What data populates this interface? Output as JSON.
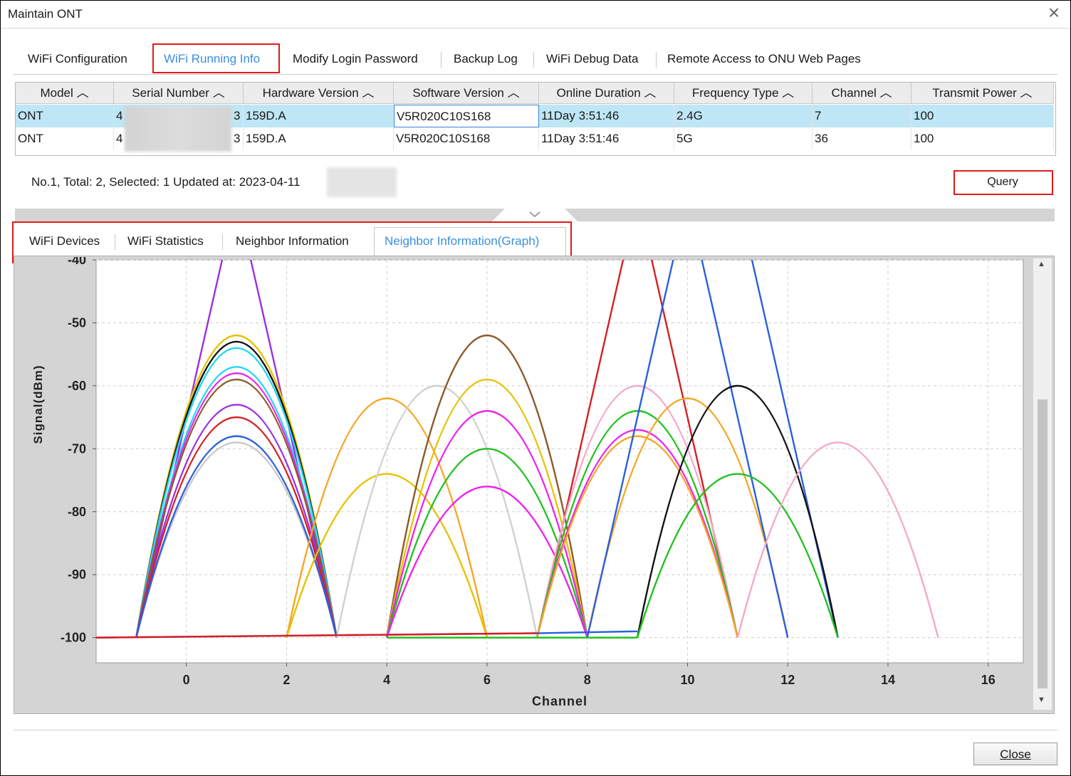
{
  "window": {
    "title": "Maintain ONT"
  },
  "top_tabs": [
    {
      "label": "WiFi Configuration",
      "active": false
    },
    {
      "label": "WiFi Running Info",
      "active": true
    },
    {
      "label": "Modify Login Password",
      "active": false
    },
    {
      "label": "Backup Log",
      "active": false
    },
    {
      "label": "WiFi Debug Data",
      "active": false
    },
    {
      "label": "Remote Access to ONU Web Pages",
      "active": false
    }
  ],
  "table": {
    "columns": [
      "Model",
      "Serial Number",
      "Hardware Version",
      "Software Version",
      "Online Duration",
      "Frequency Type",
      "Channel",
      "Transmit Power"
    ],
    "rows": [
      {
        "model": "ONT",
        "serial_start": "4",
        "serial_end": "3",
        "hardware": "159D.A",
        "software": "V5R020C10S168",
        "duration": "11Day 3:51:46",
        "frequency": "2.4G",
        "channel": "7",
        "power": "100",
        "selected": true
      },
      {
        "model": "ONT",
        "serial_start": "4",
        "serial_end": "3",
        "hardware": "159D.A",
        "software": "V5R020C10S168",
        "duration": "11Day 3:51:46",
        "frequency": "5G",
        "channel": "36",
        "power": "100",
        "selected": false
      }
    ]
  },
  "status": {
    "text": "No.1, Total: 2, Selected: 1   Updated at: 2023-04-11"
  },
  "query_button": "Query",
  "sub_tabs": [
    {
      "label": "WiFi Devices",
      "active": false
    },
    {
      "label": "WiFi Statistics",
      "active": false
    },
    {
      "label": "Neighbor Information",
      "active": false
    },
    {
      "label": "Neighbor Information(Graph)",
      "active": true
    }
  ],
  "close_button": "Close",
  "chart_data": {
    "type": "line",
    "xlabel": "Channel",
    "ylabel": "Signal(dBm)",
    "xlim": [
      -1.8,
      16.7
    ],
    "ylim": [
      -104,
      -40
    ],
    "xticks": [
      0,
      2,
      4,
      6,
      8,
      10,
      12,
      14,
      16
    ],
    "yticks": [
      -40,
      -50,
      -60,
      -70,
      -80,
      -90,
      -100
    ],
    "grid": true,
    "series": [
      {
        "color": "#9b30e0",
        "shape": "triangle",
        "values": [
          [
            -1,
            -100
          ],
          [
            1,
            -30
          ],
          [
            3,
            -100
          ]
        ]
      },
      {
        "color": "#e6c200",
        "shape": "arc",
        "values": [
          [
            -1,
            -100
          ],
          [
            1,
            -52
          ],
          [
            3,
            -100
          ]
        ]
      },
      {
        "color": "#111111",
        "shape": "arc",
        "values": [
          [
            -1,
            -100
          ],
          [
            1,
            -53
          ],
          [
            3,
            -100
          ]
        ]
      },
      {
        "color": "#22d8f0",
        "shape": "arc",
        "values": [
          [
            -1,
            -100
          ],
          [
            1,
            -54
          ],
          [
            3,
            -100
          ]
        ]
      },
      {
        "color": "#22d8f0",
        "shape": "arc",
        "values": [
          [
            -1,
            -100
          ],
          [
            1,
            -57
          ],
          [
            3,
            -100
          ]
        ]
      },
      {
        "color": "#ee22ee",
        "shape": "arc",
        "values": [
          [
            -1,
            -100
          ],
          [
            1,
            -58
          ],
          [
            3,
            -100
          ]
        ]
      },
      {
        "color": "#8b5a2b",
        "shape": "arc",
        "values": [
          [
            -1,
            -100
          ],
          [
            1,
            -59
          ],
          [
            3,
            -100
          ]
        ]
      },
      {
        "color": "#9b30e0",
        "shape": "arc",
        "values": [
          [
            -1,
            -100
          ],
          [
            1,
            -63
          ],
          [
            3,
            -100
          ]
        ]
      },
      {
        "color": "#d42020",
        "shape": "arc",
        "values": [
          [
            -1,
            -100
          ],
          [
            1,
            -65
          ],
          [
            3,
            -100
          ]
        ]
      },
      {
        "color": "#c8c8c8",
        "shape": "arc",
        "values": [
          [
            -1,
            -100
          ],
          [
            1,
            -69
          ],
          [
            3,
            -100
          ]
        ]
      },
      {
        "color": "#2a5fe0",
        "shape": "arc",
        "values": [
          [
            -1,
            -100
          ],
          [
            1,
            -68
          ],
          [
            3,
            -100
          ]
        ]
      },
      {
        "color": "#f5a623",
        "shape": "arc",
        "values": [
          [
            2,
            -100
          ],
          [
            4,
            -62
          ],
          [
            6,
            -100
          ]
        ]
      },
      {
        "color": "#e6c200",
        "shape": "arc",
        "values": [
          [
            2,
            -100
          ],
          [
            4,
            -74
          ],
          [
            6,
            -100
          ]
        ]
      },
      {
        "color": "#d0d0d0",
        "shape": "arc",
        "values": [
          [
            3,
            -100
          ],
          [
            5,
            -60
          ],
          [
            7,
            -100
          ]
        ]
      },
      {
        "color": "#8b5a2b",
        "shape": "arc",
        "values": [
          [
            4,
            -100
          ],
          [
            6,
            -52
          ],
          [
            8,
            -100
          ]
        ]
      },
      {
        "color": "#e6c200",
        "shape": "arc",
        "values": [
          [
            4,
            -100
          ],
          [
            6,
            -59
          ],
          [
            8,
            -100
          ]
        ]
      },
      {
        "color": "#ee22ee",
        "shape": "arc",
        "values": [
          [
            4,
            -100
          ],
          [
            6,
            -64
          ],
          [
            8,
            -100
          ]
        ]
      },
      {
        "color": "#22c022",
        "shape": "arc",
        "values": [
          [
            4,
            -100
          ],
          [
            6,
            -70
          ],
          [
            8,
            -100
          ]
        ]
      },
      {
        "color": "#ee22ee",
        "shape": "arc",
        "values": [
          [
            4,
            -100
          ],
          [
            6,
            -76
          ],
          [
            8,
            -100
          ]
        ]
      },
      {
        "color": "#d42020",
        "shape": "triangle",
        "values": [
          [
            7,
            -100
          ],
          [
            9,
            -30
          ],
          [
            11,
            -100
          ]
        ]
      },
      {
        "color": "#f4a8cc",
        "shape": "arc",
        "values": [
          [
            7,
            -100
          ],
          [
            9,
            -60
          ],
          [
            11,
            -100
          ]
        ]
      },
      {
        "color": "#22c022",
        "shape": "arc",
        "values": [
          [
            7,
            -100
          ],
          [
            9,
            -64
          ],
          [
            11,
            -100
          ]
        ]
      },
      {
        "color": "#ee22ee",
        "shape": "arc",
        "values": [
          [
            7,
            -100
          ],
          [
            9,
            -67
          ],
          [
            11,
            -100
          ]
        ]
      },
      {
        "color": "#f5a623",
        "shape": "arc",
        "values": [
          [
            7,
            -100
          ],
          [
            9,
            -68
          ],
          [
            11,
            -100
          ]
        ]
      },
      {
        "color": "#f5a623",
        "shape": "arc",
        "values": [
          [
            8,
            -100
          ],
          [
            10,
            -62
          ],
          [
            12,
            -100
          ]
        ]
      },
      {
        "color": "#2a5fe0",
        "shape": "triangle",
        "values": [
          [
            8,
            -100
          ],
          [
            10,
            -30
          ],
          [
            12,
            -100
          ]
        ]
      },
      {
        "color": "#2a5fe0",
        "shape": "triangle",
        "values": [
          [
            11,
            -30
          ],
          [
            13,
            -100
          ]
        ]
      },
      {
        "color": "#111111",
        "shape": "arc",
        "values": [
          [
            9,
            -100
          ],
          [
            11,
            -60
          ],
          [
            13,
            -100
          ]
        ]
      },
      {
        "color": "#22c022",
        "shape": "arc",
        "values": [
          [
            9,
            -100
          ],
          [
            11,
            -74
          ],
          [
            13,
            -100
          ]
        ]
      },
      {
        "color": "#f4a8cc",
        "shape": "arc",
        "values": [
          [
            11,
            -100
          ],
          [
            13,
            -69
          ],
          [
            15,
            -100
          ]
        ]
      },
      {
        "color": "#9b30e0",
        "shape": "line",
        "values": [
          [
            -1.8,
            -100
          ],
          [
            7,
            -99.3
          ]
        ]
      },
      {
        "color": "#d42020",
        "shape": "line",
        "values": [
          [
            -1.8,
            -100
          ],
          [
            7,
            -99.3
          ]
        ]
      },
      {
        "color": "#2a5fe0",
        "shape": "line",
        "values": [
          [
            7,
            -99.3
          ],
          [
            9,
            -99
          ]
        ]
      },
      {
        "color": "#22c022",
        "shape": "line",
        "values": [
          [
            4,
            -100
          ],
          [
            9,
            -100
          ]
        ]
      }
    ]
  }
}
